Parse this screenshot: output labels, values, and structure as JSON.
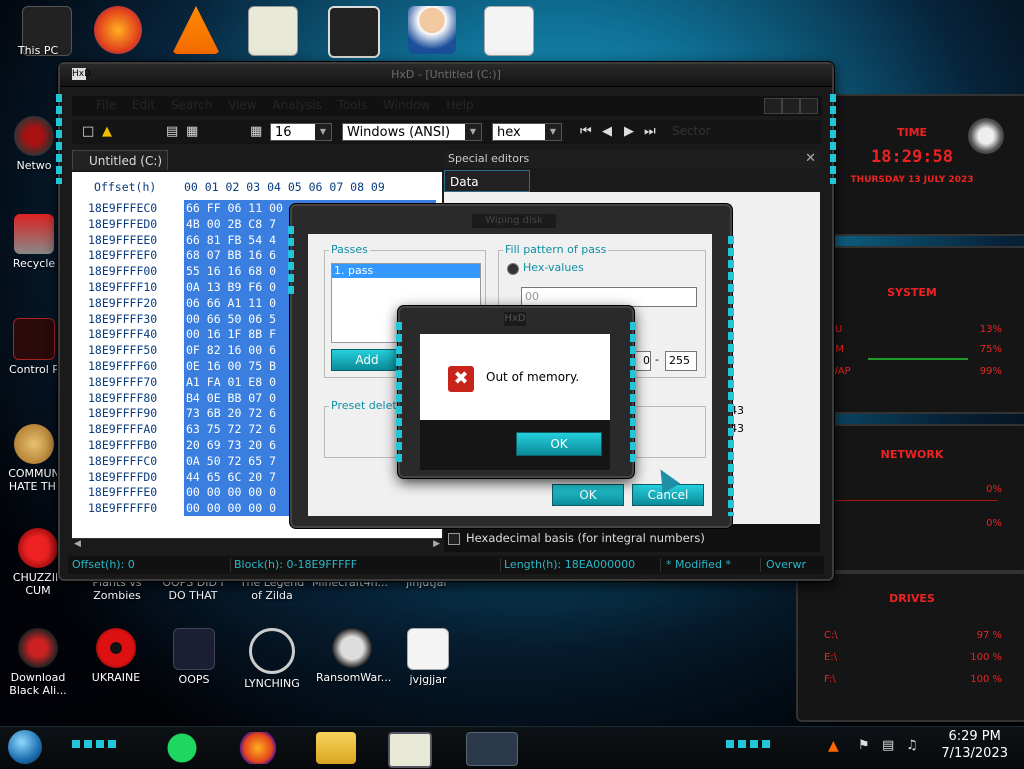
{
  "desktop": {
    "icons_left": [
      {
        "label": "This PC",
        "name": "this-pc-icon"
      },
      {
        "label": "Netwo",
        "name": "network-icon"
      },
      {
        "label": "Recycle",
        "name": "recycle-bin-icon"
      },
      {
        "label": "Control P",
        "name": "control-panel-icon"
      },
      {
        "label": "COMMUN HATE THI",
        "name": "commun-hate-icon"
      },
      {
        "label": "CHUZZIN CUM",
        "name": "chuzzin-icon"
      },
      {
        "label": "Download Black Ali...",
        "name": "download-black-alien-icon"
      },
      {
        "label": "UKRAINE",
        "name": "ukraine-icon"
      },
      {
        "label": "OOPS",
        "name": "oops-icon"
      },
      {
        "label": "LYNCHING",
        "name": "lynching-icon"
      },
      {
        "label": "RansomWar...",
        "name": "ransomware-icon"
      },
      {
        "label": "jvjgjjar",
        "name": "jvjgjjar-icon"
      }
    ],
    "partial_labels": [
      "Plants vs Zombies",
      "OOPS DID I DO THAT",
      "The Legend of Zilda",
      "Minecraft4n...",
      "jinjutjar"
    ]
  },
  "hxd": {
    "title": "HxD - [Untitled (C:)]",
    "menu": [
      "File",
      "Edit",
      "Search",
      "View",
      "Analysis",
      "Tools",
      "Window",
      "Help"
    ],
    "toolbar": {
      "columns": "16",
      "charset": "Windows (ANSI)",
      "display": "hex",
      "sector_label": "Sector"
    },
    "tab": "Untitled (C:)",
    "hex_header": {
      "offset_label": "Offset(h)",
      "cols": "00 01 02 03 04 05 06 07 08 09"
    },
    "rows": [
      {
        "offset": "18E9FFFEC0",
        "bytes": "66 FF 06 11 00"
      },
      {
        "offset": "18E9FFFED0",
        "bytes": "4B 00 2B C8 7"
      },
      {
        "offset": "18E9FFFEE0",
        "bytes": "66 81 FB 54 4"
      },
      {
        "offset": "18E9FFFEF0",
        "bytes": "68 07 BB 16 6"
      },
      {
        "offset": "18E9FFFF00",
        "bytes": "55 16 16 68 0"
      },
      {
        "offset": "18E9FFFF10",
        "bytes": "0A 13 B9 F6 0"
      },
      {
        "offset": "18E9FFFF20",
        "bytes": "06 66 A1 11 0"
      },
      {
        "offset": "18E9FFFF30",
        "bytes": "00 66 50 06 5"
      },
      {
        "offset": "18E9FFFF40",
        "bytes": "00 16 1F 8B F"
      },
      {
        "offset": "18E9FFFF50",
        "bytes": "0F 82 16 00 6"
      },
      {
        "offset": "18E9FFFF60",
        "bytes": "0E 16 00 75 B"
      },
      {
        "offset": "18E9FFFF70",
        "bytes": "A1 FA 01 E8 0"
      },
      {
        "offset": "18E9FFFF80",
        "bytes": "B4 0E BB 07 0"
      },
      {
        "offset": "18E9FFFF90",
        "bytes": "73 6B 20 72 6"
      },
      {
        "offset": "18E9FFFFA0",
        "bytes": "63 75 72 72 6"
      },
      {
        "offset": "18E9FFFFB0",
        "bytes": "20 69 73 20 6"
      },
      {
        "offset": "18E9FFFFC0",
        "bytes": "0A 50 72 65 7"
      },
      {
        "offset": "18E9FFFFD0",
        "bytes": "44 65 6C 20 7"
      },
      {
        "offset": "18E9FFFFE0",
        "bytes": "00 00 00 00 0"
      },
      {
        "offset": "18E9FFFFF0",
        "bytes": "00 00 00 00 0"
      }
    ],
    "status": {
      "offset": "Offset(h): 0",
      "block": "Block(h): 0-18E9FFFFF",
      "length": "Length(h): 18EA000000",
      "modified": "* Modified *",
      "mode": "Overwr"
    },
    "special_editors": {
      "title": "Special editors",
      "tab": "Data inspector",
      "values": [
        "43",
        "43"
      ],
      "checkbox_label": "Hexadecimal basis (for integral numbers)"
    }
  },
  "wipe_dialog": {
    "title": "Wiping disk",
    "passes_label": "Passes",
    "pass_item": "1. pass",
    "add_label": "Add",
    "fill_pattern_label": "Fill pattern of pass",
    "hex_values_label": "Hex-values",
    "hex_value": "00",
    "range_from": "0",
    "range_sep": "-",
    "range_to": "255",
    "preset_label": "Preset deletion",
    "ok_label": "OK",
    "cancel_label": "Cancel"
  },
  "message_box": {
    "title": "HxD",
    "text": "Out of memory.",
    "ok_label": "OK",
    "icon": "error-icon"
  },
  "gadget": {
    "time_label": "TIME",
    "time": "18:29:58",
    "date": "THURSDAY 13 JULY 2023",
    "system_label": "SYSTEM",
    "cpu_label": "CPU",
    "cpu": "13%",
    "ram_label": "RAM",
    "ram": "75%",
    "swap_label": "SWAP",
    "swap": "99%",
    "network_label": "NETWORK",
    "net_up": "0%",
    "net_down": "0%",
    "drives_label": "DRIVES",
    "drive_c": "C:\\",
    "drive_c_pct": "97 %",
    "drive_e": "E:\\",
    "drive_e_pct": "100 %",
    "drive_f": "F:\\",
    "drive_f_pct": "100 %"
  },
  "taskbar": {
    "time": "6:29 PM",
    "date": "7/13/2023"
  },
  "colors": {
    "accent_cyan": "#21c6d9",
    "selection_blue": "#3a7fe0",
    "gadget_red": "#e22222"
  }
}
